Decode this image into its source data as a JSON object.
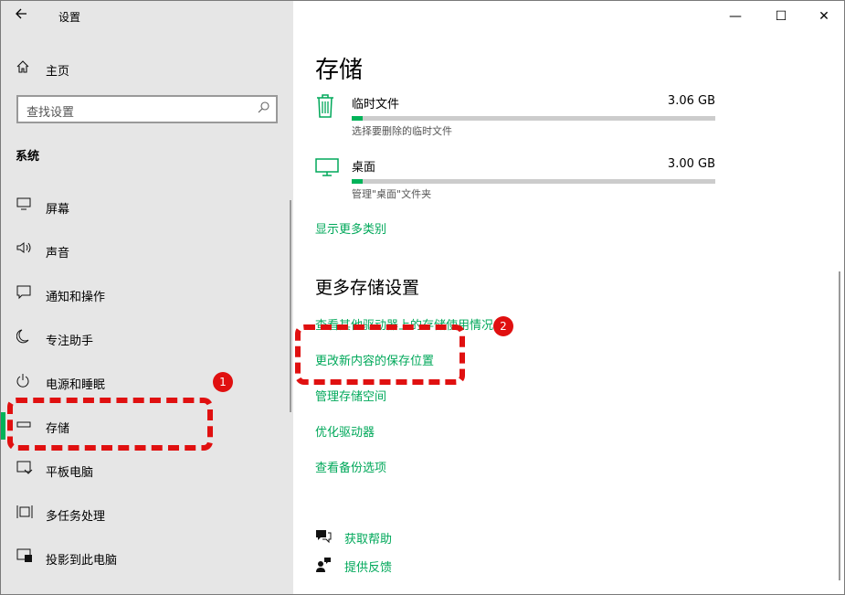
{
  "window": {
    "title": "设置",
    "minimize": "—",
    "maximize": "☐",
    "close": "✕"
  },
  "sidebar": {
    "home_label": "主页",
    "search_placeholder": "查找设置",
    "section": "系统",
    "items": [
      {
        "label": "屏幕",
        "icon": "monitor-icon"
      },
      {
        "label": "声音",
        "icon": "speaker-icon"
      },
      {
        "label": "通知和操作",
        "icon": "notification-icon"
      },
      {
        "label": "专注助手",
        "icon": "moon-icon"
      },
      {
        "label": "电源和睡眠",
        "icon": "power-icon"
      },
      {
        "label": "存储",
        "icon": "storage-icon",
        "active": true
      },
      {
        "label": "平板电脑",
        "icon": "tablet-icon"
      },
      {
        "label": "多任务处理",
        "icon": "multitask-icon"
      },
      {
        "label": "投影到此电脑",
        "icon": "project-icon"
      }
    ]
  },
  "main": {
    "title": "存储",
    "storage_items": [
      {
        "name": "临时文件",
        "size": "3.06 GB",
        "desc": "选择要删除的临时文件",
        "fill": 0.03,
        "icon": "trash-icon"
      },
      {
        "name": "桌面",
        "size": "3.00 GB",
        "desc": "管理\"桌面\"文件夹",
        "fill": 0.03,
        "icon": "desktop-icon"
      }
    ],
    "show_more": "显示更多类别",
    "more_heading": "更多存储设置",
    "links": [
      "查看其他驱动器上的存储使用情况",
      "更改新内容的保存位置",
      "管理存储空间",
      "优化驱动器",
      "查看备份选项"
    ],
    "help": {
      "get_help": "获取帮助",
      "feedback": "提供反馈"
    }
  },
  "annotations": {
    "badge1": "1",
    "badge2": "2"
  },
  "colors": {
    "accent": "#00b359",
    "link": "#00a85a",
    "annotation": "#e01010",
    "sidebar_bg": "#e6e6e6"
  }
}
